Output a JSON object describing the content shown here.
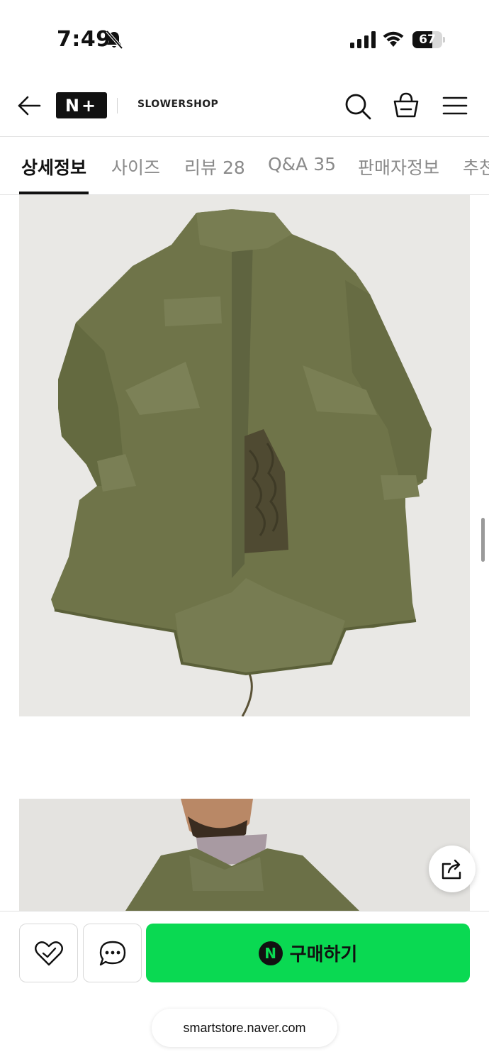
{
  "status_bar": {
    "time": "7:49",
    "battery": "67",
    "battery_level": 0.67,
    "icons": [
      "bell-slash-icon",
      "signal-icon",
      "wifi-icon",
      "battery-icon"
    ]
  },
  "header": {
    "logo_text": "N+",
    "shop_name": "SLOWERSHOP",
    "icons": [
      "back-arrow-icon",
      "search-icon",
      "cart-icon",
      "menu-icon"
    ]
  },
  "tabs": [
    {
      "label": "상세정보",
      "active": true
    },
    {
      "label": "사이즈",
      "active": false
    },
    {
      "label": "리뷰 28",
      "active": false
    },
    {
      "label": "Q&A 35",
      "active": false
    },
    {
      "label": "판매자정보",
      "active": false
    },
    {
      "label": "추천",
      "active": false
    }
  ],
  "colors": {
    "accent_green": "#0ad952",
    "jacket_olive": "#6b7048",
    "text_primary": "#111111",
    "text_muted": "#8a8a8a"
  },
  "bottom_bar": {
    "buy_icon_text": "N",
    "buy_label": "구매하기",
    "icons": [
      "heart-check-icon",
      "chat-bubble-icon"
    ]
  },
  "url": "smartstore.naver.com"
}
